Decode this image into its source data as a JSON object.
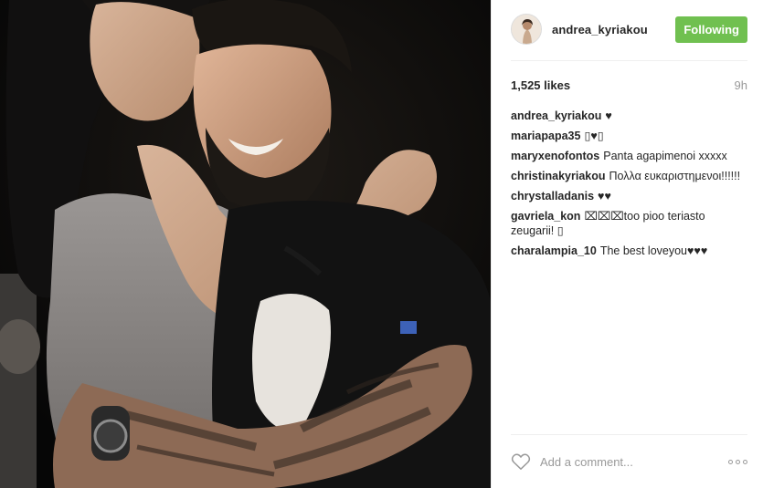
{
  "post": {
    "username": "andrea_kyriakou",
    "follow_label": "Following",
    "likes": "1,525 likes",
    "age": "9h",
    "comments": [
      {
        "user": "andrea_kyriakou",
        "text": "♥"
      },
      {
        "user": "mariapapa35",
        "text": "▯♥▯"
      },
      {
        "user": "maryxenofontos",
        "text": "Panta agapimenoi xxxxx"
      },
      {
        "user": "christinakyriakou",
        "text": "Πολλα ευκαριστημενοι!!!!!!"
      },
      {
        "user": "chrystalladanis",
        "text": "♥♥"
      },
      {
        "user": "gavriela_kon",
        "text": "⌧⌧⌧too pioo teriasto zeugarii! ▯"
      },
      {
        "user": "charalampia_10",
        "text": "The best loveyou♥♥♥"
      }
    ],
    "add_comment_placeholder": "Add a comment...",
    "colors": {
      "follow_button": "#70c050",
      "text": "#262626",
      "muted": "#999999"
    }
  }
}
